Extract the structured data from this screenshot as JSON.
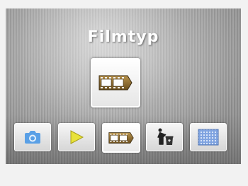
{
  "screen": {
    "title": "Filmtyp"
  },
  "menu": {
    "items": [
      {
        "icon": "camera-icon",
        "selected": false
      },
      {
        "icon": "play-icon",
        "selected": false
      },
      {
        "icon": "film-strip-icon",
        "selected": true
      },
      {
        "icon": "trash-icon",
        "selected": false
      },
      {
        "icon": "pattern-icon",
        "selected": false
      }
    ]
  },
  "colors": {
    "accent_blue": "#5aa0e6",
    "play_yellow": "#e8e23a",
    "film_brown": "#8a6a2a",
    "pattern_blue": "#7fa3e0"
  }
}
